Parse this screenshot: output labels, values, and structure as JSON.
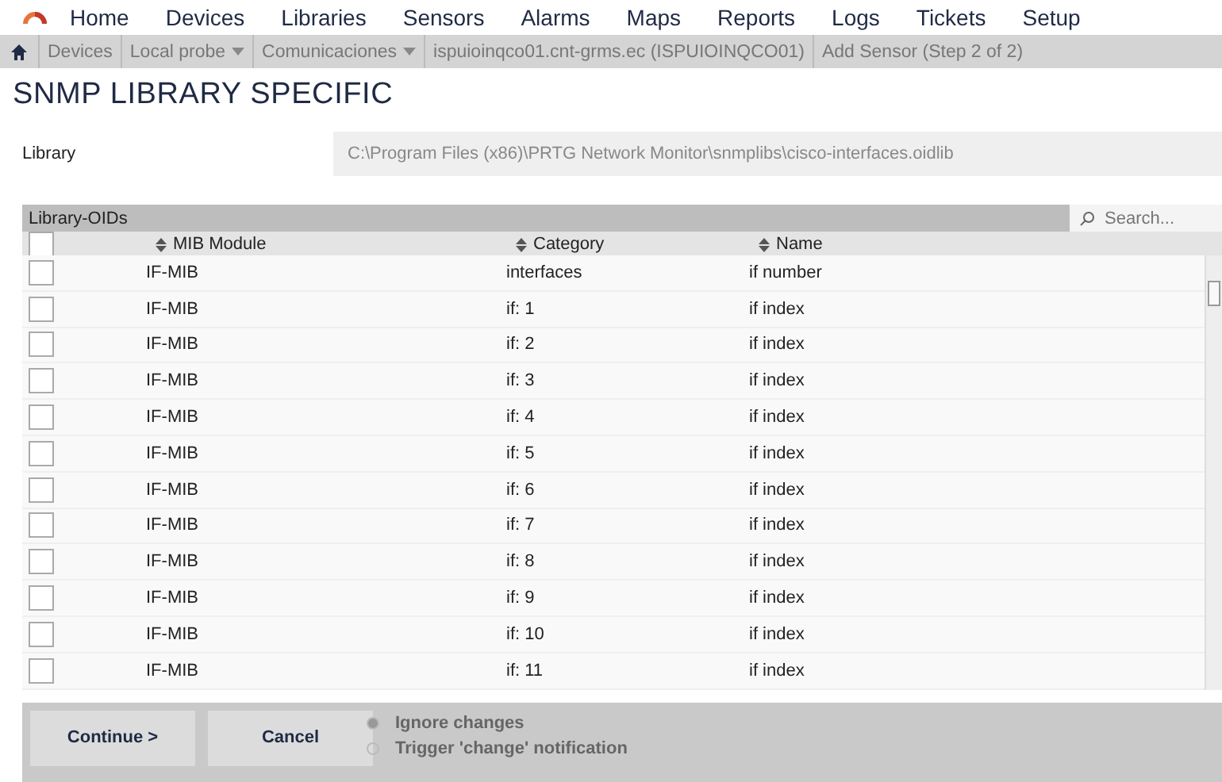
{
  "menu": [
    "Home",
    "Devices",
    "Libraries",
    "Sensors",
    "Alarms",
    "Maps",
    "Reports",
    "Logs",
    "Tickets",
    "Setup"
  ],
  "breadcrumb": [
    {
      "label": "Devices",
      "dropdown": false
    },
    {
      "label": "Local probe",
      "dropdown": true
    },
    {
      "label": "Comunicaciones",
      "dropdown": true
    },
    {
      "label": "ispuioinqco01.cnt-grms.ec (ISPUIOINQCO01)",
      "dropdown": false
    },
    {
      "label": "Add Sensor (Step 2 of 2)",
      "dropdown": false
    }
  ],
  "title": "SNMP LIBRARY SPECIFIC",
  "library": {
    "label": "Library",
    "value": "C:\\Program Files (x86)\\PRTG Network Monitor\\snmplibs\\cisco-interfaces.oidlib"
  },
  "table": {
    "title": "Library-OIDs",
    "search": {
      "placeholder": "Search..."
    },
    "select_all": {
      "checked": false
    },
    "columns": [
      "MIB Module",
      "Category",
      "Name"
    ],
    "rows": [
      {
        "checked": false,
        "cells": [
          "IF-MIB",
          "interfaces",
          "if number"
        ]
      },
      {
        "checked": false,
        "cells": [
          "IF-MIB",
          "if: 1",
          "if index"
        ]
      },
      {
        "checked": false,
        "cells": [
          "IF-MIB",
          "if: 2",
          "if index"
        ]
      },
      {
        "checked": false,
        "cells": [
          "IF-MIB",
          "if: 3",
          "if index"
        ]
      },
      {
        "checked": false,
        "cells": [
          "IF-MIB",
          "if: 4",
          "if index"
        ]
      },
      {
        "checked": false,
        "cells": [
          "IF-MIB",
          "if: 5",
          "if index"
        ]
      },
      {
        "checked": false,
        "cells": [
          "IF-MIB",
          "if: 6",
          "if index"
        ]
      },
      {
        "checked": false,
        "cells": [
          "IF-MIB",
          "if: 7",
          "if index"
        ]
      },
      {
        "checked": false,
        "cells": [
          "IF-MIB",
          "if: 8",
          "if index"
        ]
      },
      {
        "checked": false,
        "cells": [
          "IF-MIB",
          "if: 9",
          "if index"
        ]
      },
      {
        "checked": false,
        "cells": [
          "IF-MIB",
          "if: 10",
          "if index"
        ]
      },
      {
        "checked": false,
        "cells": [
          "IF-MIB",
          "if: 11",
          "if index"
        ]
      }
    ]
  },
  "footer": {
    "buttons": [
      "Continue >",
      "Cancel"
    ],
    "options": [
      {
        "label": "Ignore changes",
        "selected": true
      },
      {
        "label": "Trigger 'change' notification",
        "selected": false
      }
    ]
  }
}
